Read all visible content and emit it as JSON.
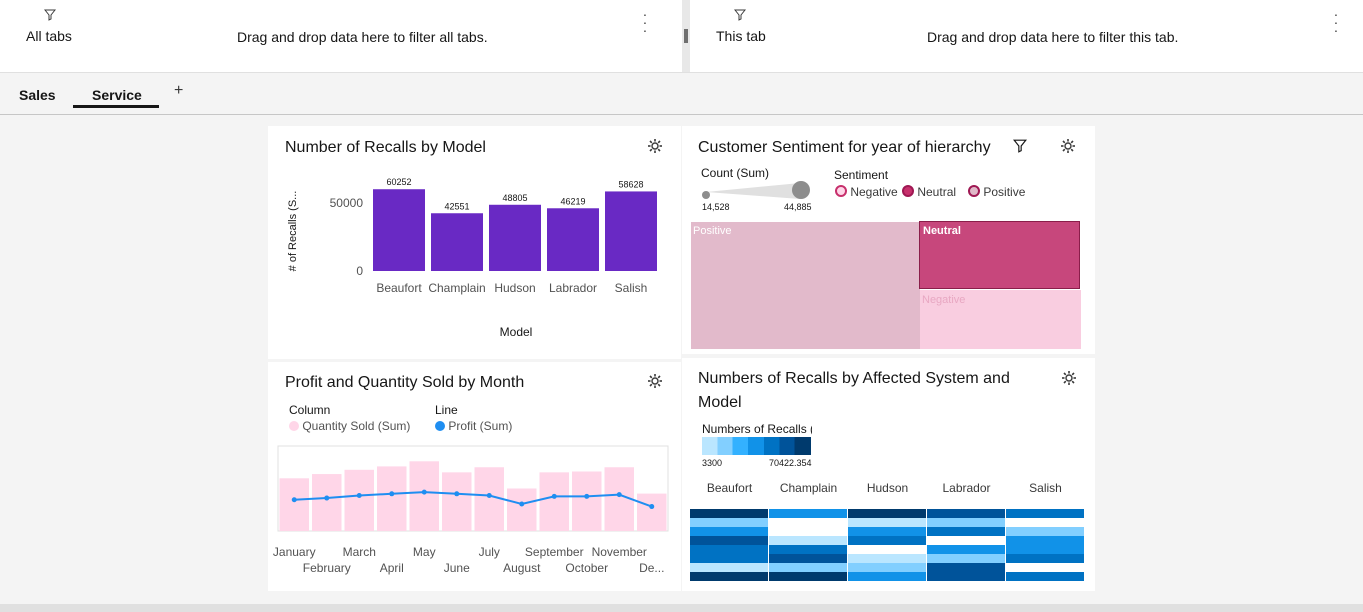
{
  "filters": {
    "all_tabs_label": "All tabs",
    "all_tabs_drop": "Drag and drop data here to filter all tabs.",
    "this_tab_label": "This tab",
    "this_tab_drop": "Drag and drop data here to filter this tab."
  },
  "tabs": [
    {
      "label": "Sales",
      "active": false
    },
    {
      "label": "Service",
      "active": true
    }
  ],
  "add_tab_label": "+",
  "widgets": {
    "recalls_by_model": {
      "title": "Number of Recalls by Model",
      "ylabel": "# of Recalls (S...",
      "xlabel": "Model",
      "yticks": [
        "50000",
        "0"
      ],
      "color": "#6929c4"
    },
    "sentiment": {
      "title": "Customer Sentiment for year of hierarchy",
      "size_legend_title": "Count (Sum)",
      "size_min": "14,528",
      "size_max": "44,885",
      "color_legend_title": "Sentiment",
      "legend": [
        {
          "label": "Negative",
          "color": "#ffb3d2"
        },
        {
          "label": "Neutral",
          "color": "#c7306c"
        },
        {
          "label": "Positive",
          "color": "#e0b8c8"
        }
      ],
      "tiles": [
        {
          "label": "Positive"
        },
        {
          "label": "Neutral"
        },
        {
          "label": "Negative"
        }
      ]
    },
    "profit_quantity": {
      "title": "Profit and Quantity Sold by Month",
      "legend_column_title": "Column",
      "legend_column_item": "Quantity Sold (Sum)",
      "legend_line_title": "Line",
      "legend_line_item": "Profit (Sum)",
      "column_color": "#ffd6e8",
      "line_color": "#1f8ef1"
    },
    "recalls_system": {
      "title_line1": "Numbers of Recalls by Affected System and",
      "title_line2": "Model",
      "legend_title": "Numbers of Recalls (",
      "legend_min": "3300",
      "legend_max": "70422.354",
      "columns": [
        "Beaufort",
        "Champlain",
        "Hudson",
        "Labrador",
        "Salish"
      ]
    }
  },
  "chart_data": [
    {
      "type": "bar",
      "title": "Number of Recalls by Model",
      "categories": [
        "Beaufort",
        "Champlain",
        "Hudson",
        "Labrador",
        "Salish"
      ],
      "values": [
        60252,
        42551,
        48805,
        46219,
        58628
      ],
      "xlabel": "Model",
      "ylabel": "# of Recalls (S...",
      "ylim": [
        0,
        70000
      ]
    },
    {
      "type": "treemap",
      "title": "Customer Sentiment for year of hierarchy",
      "categories": [
        "Positive",
        "Neutral",
        "Negative"
      ],
      "values": [
        44885,
        14528,
        14600
      ]
    },
    {
      "type": "bar+line",
      "title": "Profit and Quantity Sold by Month",
      "categories": [
        "January",
        "February",
        "March",
        "April",
        "May",
        "June",
        "July",
        "August",
        "September",
        "October",
        "November",
        "December"
      ],
      "series": [
        {
          "name": "Quantity Sold (Sum)",
          "type": "bar",
          "values": [
            62,
            67,
            72,
            76,
            82,
            69,
            75,
            50,
            69,
            70,
            75,
            44
          ]
        },
        {
          "name": "Profit (Sum)",
          "type": "line",
          "values": [
            25,
            27,
            30,
            32,
            34,
            32,
            30,
            20,
            29,
            29,
            31,
            17
          ]
        }
      ],
      "ylim": [
        0,
        100
      ]
    },
    {
      "type": "heatmap",
      "title": "Numbers of Recalls by Affected System and Model",
      "columns": [
        "Beaufort",
        "Champlain",
        "Hudson",
        "Labrador",
        "Salish"
      ],
      "range": [
        3300,
        70422.354
      ],
      "cells": [
        [
          0.95,
          0.35,
          0.55,
          0.9,
          0.7,
          0.7,
          0.1,
          0.95
        ],
        [
          0.6,
          0.05,
          0.05,
          0.1,
          0.65,
          0.85,
          0.3,
          0.95
        ],
        [
          0.95,
          0.2,
          0.5,
          0.7,
          0.05,
          0.2,
          0.35,
          0.6
        ],
        [
          0.85,
          0.3,
          0.7,
          0.05,
          0.55,
          0.25,
          0.85,
          0.85
        ],
        [
          0.65,
          0.05,
          0.25,
          0.6,
          0.55,
          0.75,
          0.05,
          0.65
        ]
      ]
    }
  ]
}
